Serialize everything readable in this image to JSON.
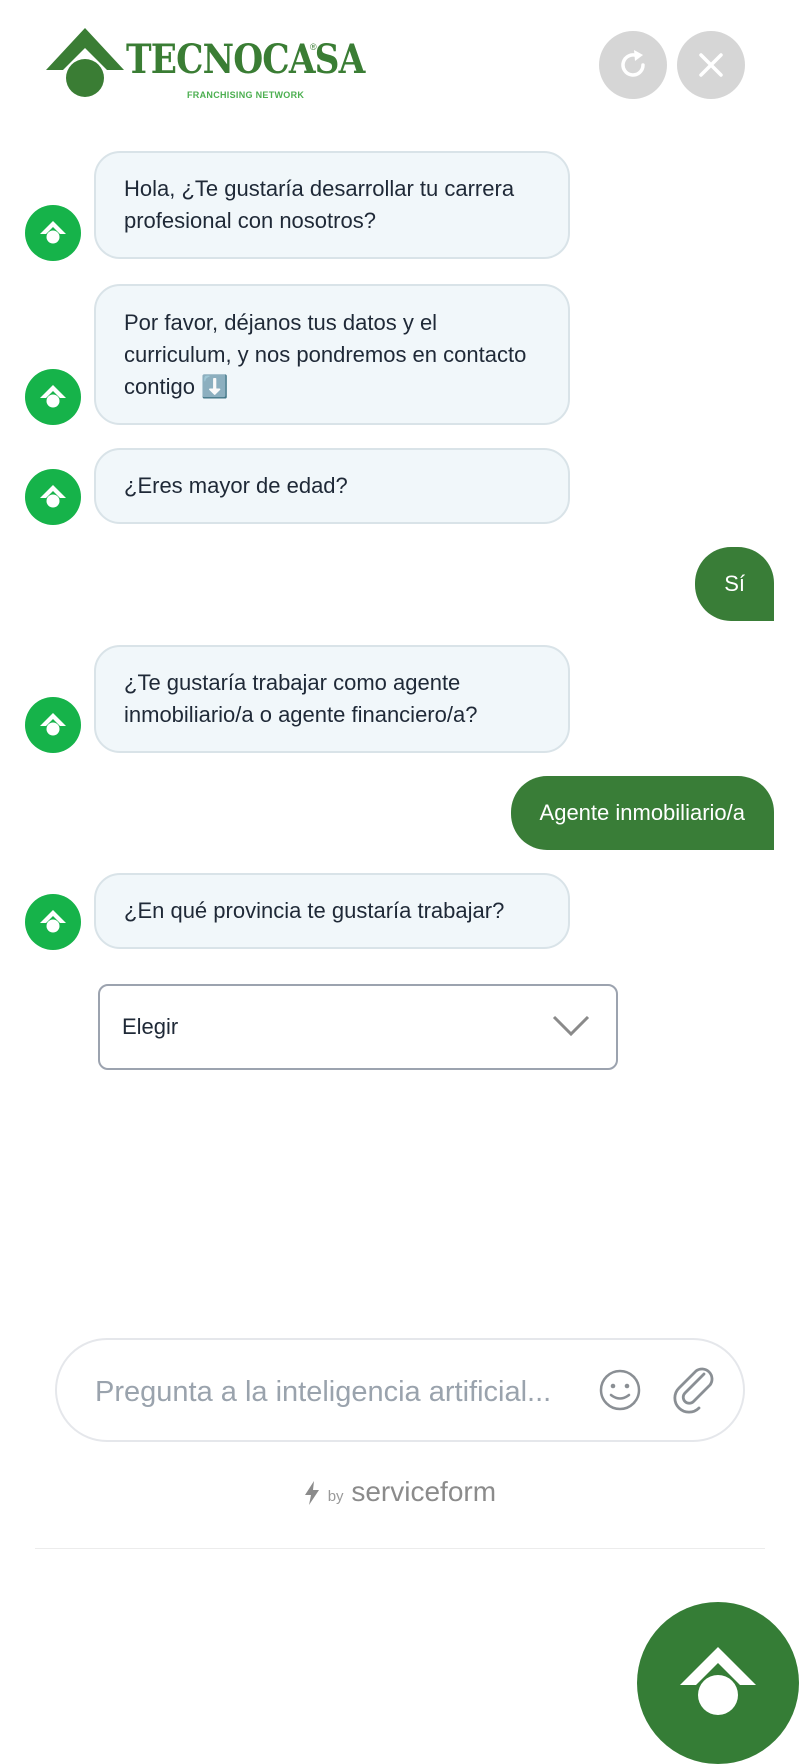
{
  "header": {
    "logo_text": "TECNOCASA",
    "logo_reg": "®",
    "logo_subtitle": "FRANCHISING NETWORK",
    "refresh_icon": "refresh-icon",
    "close_icon": "close-icon"
  },
  "messages": [
    {
      "from": "bot",
      "text": "Hola, ¿Te gustaría desarrollar tu carrera profesional con nosotros?"
    },
    {
      "from": "bot",
      "text": "Por favor, déjanos tus datos y el curriculum, y nos pondremos en contacto contigo ⬇️"
    },
    {
      "from": "bot",
      "text": "¿Eres mayor de edad?"
    },
    {
      "from": "user",
      "text": "Sí"
    },
    {
      "from": "bot",
      "text": "¿Te gustaría trabajar como agente inmobiliario/a o agente financiero/a?"
    },
    {
      "from": "user",
      "text": "Agente inmobiliario/a"
    },
    {
      "from": "bot",
      "text": "¿En qué provincia te gustaría trabajar?"
    }
  ],
  "province_select": {
    "selected": "Elegir"
  },
  "composer": {
    "placeholder": "Pregunta a la inteligencia artificial..."
  },
  "footer": {
    "by": "by",
    "brand": "serviceform"
  },
  "colors": {
    "brand_green": "#397d37",
    "avatar_green": "#16b34a",
    "bot_bubble": "#f1f7fa"
  }
}
